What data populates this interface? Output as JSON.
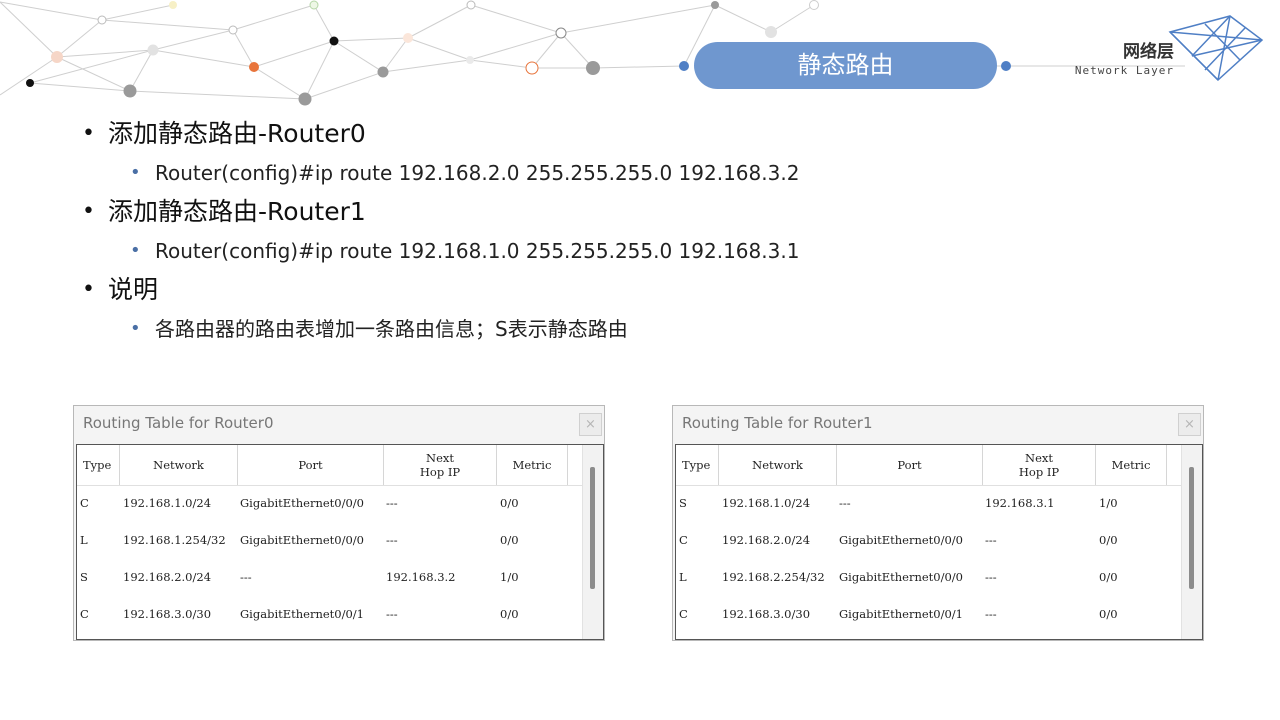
{
  "header": {
    "title": "静态路由",
    "brand_cn": "网络层",
    "brand_en": "Network Layer"
  },
  "bullets": [
    {
      "label": "添加静态路由-Router0",
      "sub": "Router(config)#ip route 192.168.2.0 255.255.255.0 192.168.3.2"
    },
    {
      "label": "添加静态路由-Router1",
      "sub": "Router(config)#ip route 192.168.1.0 255.255.255.0 192.168.3.1"
    },
    {
      "label": "说明",
      "sub": "各路由器的路由表增加一条路由信息；S表示静态路由"
    }
  ],
  "routing_tables": [
    {
      "title": "Routing Table for Router0",
      "close_label": "×",
      "headers": {
        "type": "Type",
        "network": "Network",
        "port": "Port",
        "next_hop": "Next\nHop IP",
        "metric": "Metric"
      },
      "rows": [
        {
          "type": "C",
          "network": "192.168.1.0/24",
          "port": "GigabitEthernet0/0/0",
          "next_hop": "---",
          "metric": "0/0"
        },
        {
          "type": "L",
          "network": "192.168.1.254/32",
          "port": "GigabitEthernet0/0/0",
          "next_hop": "---",
          "metric": "0/0"
        },
        {
          "type": "S",
          "network": "192.168.2.0/24",
          "port": "---",
          "next_hop": "192.168.3.2",
          "metric": "1/0"
        },
        {
          "type": "C",
          "network": "192.168.3.0/30",
          "port": "GigabitEthernet0/0/1",
          "next_hop": "---",
          "metric": "0/0"
        }
      ]
    },
    {
      "title": "Routing Table for Router1",
      "close_label": "×",
      "headers": {
        "type": "Type",
        "network": "Network",
        "port": "Port",
        "next_hop": "Next\nHop IP",
        "metric": "Metric"
      },
      "rows": [
        {
          "type": "S",
          "network": "192.168.1.0/24",
          "port": "---",
          "next_hop": "192.168.3.1",
          "metric": "1/0"
        },
        {
          "type": "C",
          "network": "192.168.2.0/24",
          "port": "GigabitEthernet0/0/0",
          "next_hop": "---",
          "metric": "0/0"
        },
        {
          "type": "L",
          "network": "192.168.2.254/32",
          "port": "GigabitEthernet0/0/0",
          "next_hop": "---",
          "metric": "0/0"
        },
        {
          "type": "C",
          "network": "192.168.3.0/30",
          "port": "GigabitEthernet0/0/1",
          "next_hop": "---",
          "metric": "0/0"
        }
      ]
    }
  ],
  "colors": {
    "accent": "#6f97cf",
    "node_orange": "#e8743b",
    "node_gray": "#9a9a9a",
    "node_black": "#111111"
  }
}
